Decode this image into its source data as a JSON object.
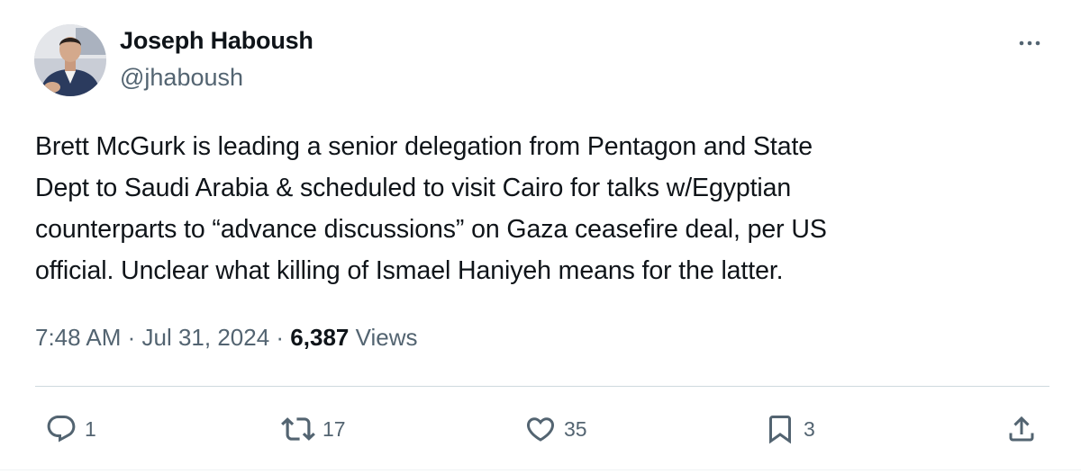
{
  "author": {
    "name": "Joseph Haboush",
    "handle": "@jhaboush"
  },
  "tweet": {
    "text_lines": [
      "Brett McGurk is leading a senior delegation from Pentagon and State",
      "Dept to Saudi Arabia & scheduled to visit Cairo for talks w/Egyptian",
      "counterparts to “advance discussions” on Gaza ceasefire deal, per US",
      "official. Unclear what killing of Ismael Haniyeh means for the latter."
    ]
  },
  "meta": {
    "time": "7:48 AM",
    "separator": " · ",
    "date": "Jul 31, 2024",
    "views_count": "6,387",
    "views_label": "Views"
  },
  "actions": {
    "replies": "1",
    "reposts": "17",
    "likes": "35",
    "bookmarks": "3"
  },
  "icons": {
    "more": "more-horizontal-icon",
    "reply": "reply-icon",
    "repost": "repost-icon",
    "like": "heart-icon",
    "bookmark": "bookmark-icon",
    "share": "share-icon"
  },
  "colors": {
    "text": "#0f1419",
    "secondary_text": "#536471",
    "divider": "#cfd9de"
  }
}
